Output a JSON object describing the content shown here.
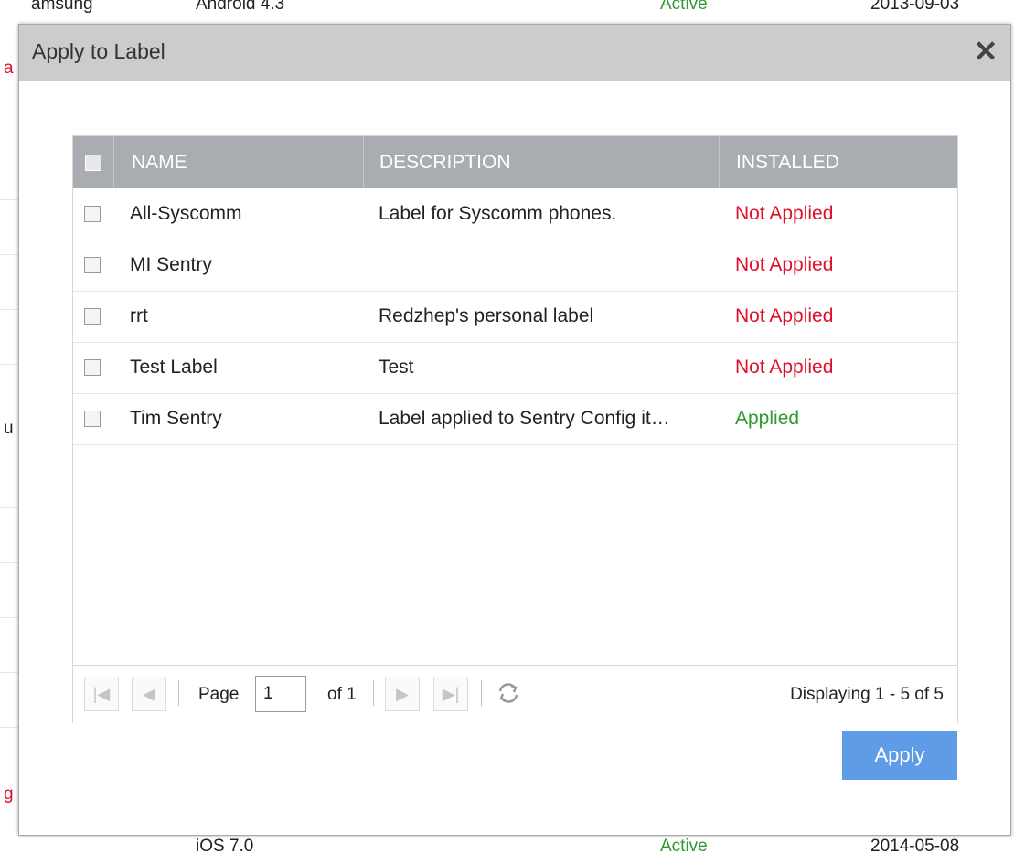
{
  "background": {
    "top_row": {
      "device": "amsung",
      "os": "Android 4.3",
      "status": "Active",
      "date": "2013-09-03"
    },
    "bottom_row": {
      "os": "iOS 7.0",
      "status": "Active",
      "date": "2014-05-08"
    },
    "fragments": [
      "a",
      "u",
      "g"
    ]
  },
  "modal": {
    "title": "Apply to Label",
    "close_icon": "close-icon",
    "grid": {
      "columns": [
        "NAME",
        "DESCRIPTION",
        "INSTALLED"
      ],
      "rows": [
        {
          "name": "All-Syscomm",
          "description": "Label for Syscomm phones.",
          "installed": "Not Applied"
        },
        {
          "name": "MI Sentry",
          "description": "",
          "installed": "Not Applied"
        },
        {
          "name": "rrt",
          "description": "Redzhep's personal label",
          "installed": "Not Applied"
        },
        {
          "name": "Test Label",
          "description": "Test",
          "installed": "Not Applied"
        },
        {
          "name": "Tim Sentry",
          "description": "Label applied to Sentry Config it…",
          "installed": "Applied"
        }
      ]
    },
    "pager": {
      "page_label": "Page",
      "page_value": "1",
      "of_label": "of 1",
      "displaying": "Displaying 1 - 5 of 5"
    },
    "apply_label": "Apply"
  },
  "colors": {
    "not_applied": "#e0102a",
    "applied": "#2f9a2f",
    "apply_button": "#5f9ce8",
    "header_bar": "#cccccc",
    "grid_header": "#a9adb2"
  }
}
